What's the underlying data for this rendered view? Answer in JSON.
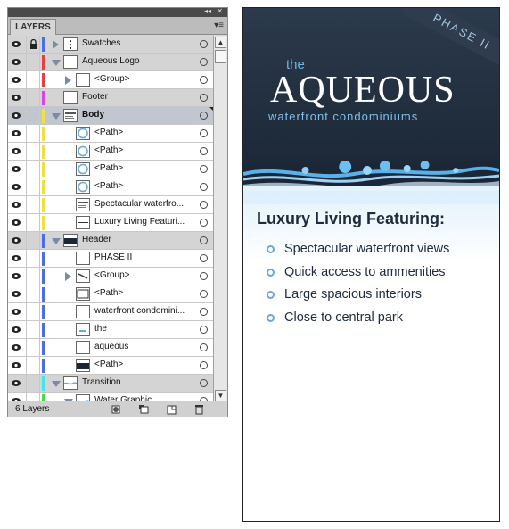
{
  "panel": {
    "tab_label": "LAYERS",
    "footer": {
      "layer_count": "6 Layers"
    },
    "rows": [
      {
        "name": "Swatches",
        "type": "layer",
        "color": "#4a6cf0",
        "expand": "right",
        "locked": true,
        "thumb": "swatches"
      },
      {
        "name": "Aqueous Logo",
        "type": "layer",
        "color": "#e84040",
        "expand": "down",
        "locked": false,
        "thumb": "blank"
      },
      {
        "name": "<Group>",
        "type": "item",
        "color": "#e84040",
        "expand": "right",
        "locked": false,
        "thumb": "blank"
      },
      {
        "name": "Footer",
        "type": "layer",
        "color": "#e040e8",
        "expand": "none",
        "locked": false,
        "thumb": "blank"
      },
      {
        "name": "Body",
        "type": "layer",
        "color": "#f0e040",
        "expand": "down",
        "locked": false,
        "thumb": "text",
        "selected": true
      },
      {
        "name": "<Path>",
        "type": "item",
        "color": "#f0e040",
        "expand": "none",
        "locked": false,
        "thumb": "circle"
      },
      {
        "name": "<Path>",
        "type": "item",
        "color": "#f0e040",
        "expand": "none",
        "locked": false,
        "thumb": "circle"
      },
      {
        "name": "<Path>",
        "type": "item",
        "color": "#f0e040",
        "expand": "none",
        "locked": false,
        "thumb": "circle"
      },
      {
        "name": "<Path>",
        "type": "item",
        "color": "#f0e040",
        "expand": "none",
        "locked": false,
        "thumb": "circle"
      },
      {
        "name": "Spectacular waterfro...",
        "type": "item",
        "color": "#f0e040",
        "expand": "none",
        "locked": false,
        "thumb": "text"
      },
      {
        "name": "Luxury Living Featuri...",
        "type": "item",
        "color": "#f0e040",
        "expand": "none",
        "locked": false,
        "thumb": "line"
      },
      {
        "name": "Header",
        "type": "layer",
        "color": "#4a6cf0",
        "expand": "down",
        "locked": false,
        "thumb": "dark"
      },
      {
        "name": "PHASE II",
        "type": "item",
        "color": "#4a6cf0",
        "expand": "none",
        "locked": false,
        "thumb": "blank"
      },
      {
        "name": "<Group>",
        "type": "item",
        "color": "#4a6cf0",
        "expand": "right",
        "locked": false,
        "thumb": "slash"
      },
      {
        "name": "<Path>",
        "type": "item",
        "color": "#4a6cf0",
        "expand": "none",
        "locked": false,
        "thumb": "frame"
      },
      {
        "name": "waterfront condomini...",
        "type": "item",
        "color": "#4a6cf0",
        "expand": "none",
        "locked": false,
        "thumb": "blank"
      },
      {
        "name": "the",
        "type": "item",
        "color": "#4a6cf0",
        "expand": "none",
        "locked": false,
        "thumb": "small-text"
      },
      {
        "name": "aqueous",
        "type": "item",
        "color": "#4a6cf0",
        "expand": "none",
        "locked": false,
        "thumb": "blank"
      },
      {
        "name": "<Path>",
        "type": "item",
        "color": "#4a6cf0",
        "expand": "none",
        "locked": false,
        "thumb": "dark"
      },
      {
        "name": "Transition",
        "type": "layer",
        "color": "#40e8e8",
        "expand": "down",
        "locked": false,
        "thumb": "wave"
      },
      {
        "name": "Water Graphic",
        "type": "item",
        "color": "#40e040",
        "expand": "down",
        "locked": false,
        "thumb": "wave"
      }
    ]
  },
  "artboard": {
    "banner": "PHASE II",
    "logo_small": "the",
    "logo_main": "AQUEOUS",
    "tagline": "waterfront condominiums",
    "body_title": "Luxury Living Featuring:",
    "features": [
      "Spectacular waterfront views",
      "Quick access to ammenities",
      "Large spacious interiors",
      "Close to central park"
    ]
  }
}
